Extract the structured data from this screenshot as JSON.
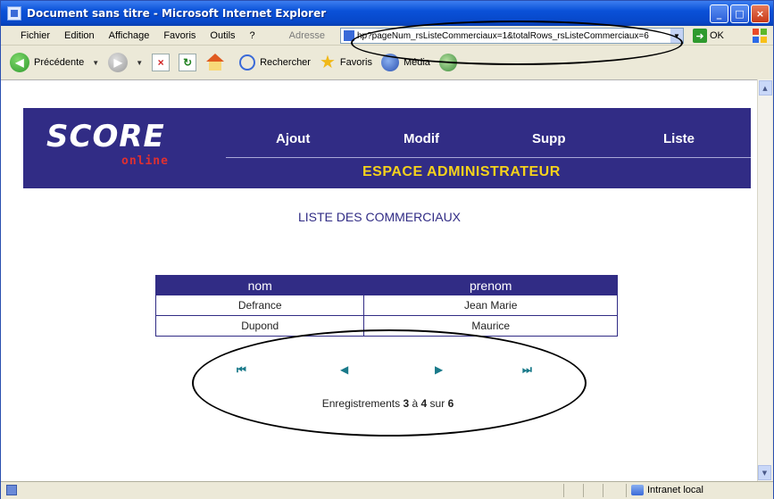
{
  "window": {
    "title": "Document sans titre - Microsoft Internet Explorer",
    "buttons": {
      "minimize": "_",
      "maximize": "□",
      "close": "×"
    }
  },
  "menubar": {
    "items": [
      "Fichier",
      "Edition",
      "Affichage",
      "Favoris",
      "Outils",
      "?"
    ],
    "address_label": "Adresse",
    "address_value": "hp?pageNum_rsListeCommerciaux=1&totalRows_rsListeCommerciaux=6",
    "go_label": "OK"
  },
  "toolbar": {
    "back_label": "Précédente",
    "search_label": "Rechercher",
    "favorites_label": "Favoris",
    "media_label": "Média"
  },
  "page": {
    "logo_main": "SCORE",
    "logo_sub": "online",
    "nav": [
      "Ajout",
      "Modif",
      "Supp",
      "Liste"
    ],
    "espace_title": "ESPACE ADMINISTRATEUR",
    "list_title": "LISTE DES COMMERCIAUX",
    "table": {
      "headers": [
        "nom",
        "prenom"
      ],
      "rows": [
        [
          "Defrance",
          "Jean Marie"
        ],
        [
          "Dupond",
          "Maurice"
        ]
      ]
    },
    "pager": {
      "first": "⏮",
      "prev": "◀",
      "next": "▶",
      "last": "⏭",
      "status_prefix": "Enregistrements",
      "from": "3",
      "middle": "à",
      "to": "4",
      "sep": "sur",
      "total": "6"
    }
  },
  "statusbar": {
    "zone_label": "Intranet local"
  },
  "colors": {
    "banner": "#312c85",
    "accent_yellow": "#f5d21c",
    "logo_red": "#e03030",
    "pager_teal": "#1a7a8a"
  }
}
